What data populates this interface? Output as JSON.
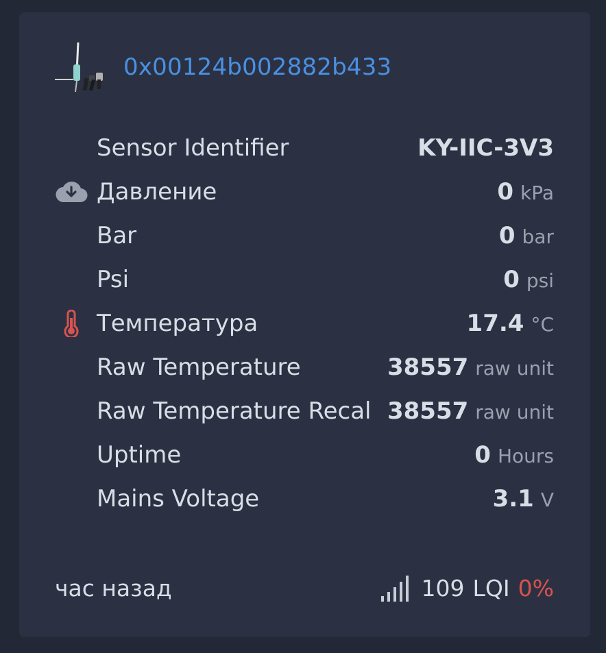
{
  "device": {
    "address": "0x00124b002882b433",
    "image_icon": "sensor-probe-image"
  },
  "rows": [
    {
      "label": "Sensor Identifier",
      "value": "KY-IIC-3V3",
      "unit": "",
      "icon": ""
    },
    {
      "label": "Давление",
      "value": "0",
      "unit": "kPa",
      "icon": "cloud-download-icon",
      "icon_color": "#9aa1ae"
    },
    {
      "label": "Bar",
      "value": "0",
      "unit": "bar",
      "icon": ""
    },
    {
      "label": "Psi",
      "value": "0",
      "unit": "psi",
      "icon": ""
    },
    {
      "label": "Температура",
      "value": "17.4",
      "unit": "°C",
      "icon": "thermometer-icon",
      "icon_color": "#d9534f"
    },
    {
      "label": "Raw Temperature",
      "value": "38557",
      "unit": "raw unit",
      "icon": ""
    },
    {
      "label": "Raw Temperature Recal",
      "value": "38557",
      "unit": "raw unit",
      "icon": ""
    },
    {
      "label": "Uptime",
      "value": "0",
      "unit": "Hours",
      "icon": ""
    },
    {
      "label": "Mains Voltage",
      "value": "3.1",
      "unit": "V",
      "icon": ""
    }
  ],
  "footer": {
    "last_seen": "час назад",
    "lqi_value": "109",
    "lqi_label": "LQI",
    "battery_percent": "0%",
    "signal_icon": "signal-bars-icon"
  },
  "colors": {
    "background": "#222836",
    "card": "#2b3142",
    "link": "#4a90e2",
    "danger": "#d9534f",
    "text": "#d9dde6",
    "muted": "#9aa1ae"
  }
}
